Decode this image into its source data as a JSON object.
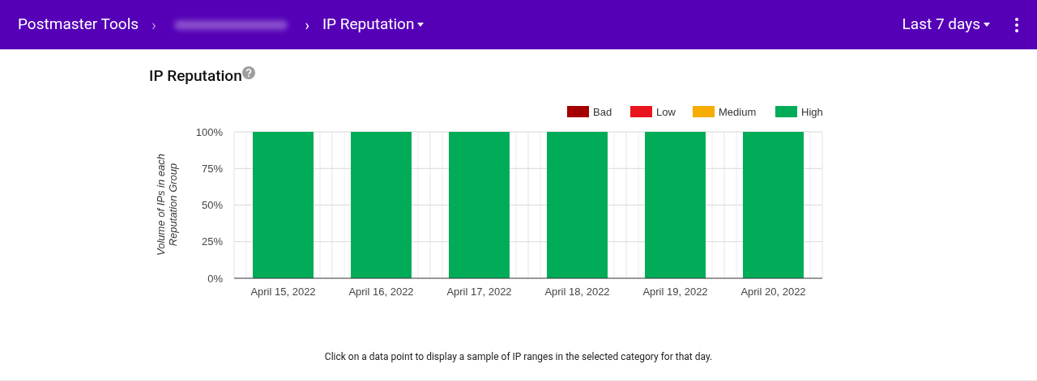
{
  "header": {
    "app_title": "Postmaster Tools",
    "separator": "›",
    "page_menu": "IP Reputation",
    "date_range": "Last 7 days"
  },
  "section": {
    "title": "IP Reputation",
    "chart_data": {
      "type": "bar",
      "stacked": true,
      "grid": true,
      "ylabel": "Volume of IPs in each Reputation Group",
      "categories": [
        "April 15, 2022",
        "April 16, 2022",
        "April 17, 2022",
        "April 18, 2022",
        "April 19, 2022",
        "April 20, 2022"
      ],
      "ylim": [
        0,
        100
      ],
      "yticks": [
        {
          "value": 0,
          "label": "0%"
        },
        {
          "value": 25,
          "label": "25%"
        },
        {
          "value": 50,
          "label": "50%"
        },
        {
          "value": 75,
          "label": "75%"
        },
        {
          "value": 100,
          "label": "100%"
        }
      ],
      "series": [
        {
          "name": "Bad",
          "color": "#a50000",
          "values": [
            0,
            0,
            0,
            0,
            0,
            0
          ]
        },
        {
          "name": "Low",
          "color": "#e8141e",
          "values": [
            0,
            0,
            0,
            0,
            0,
            0
          ]
        },
        {
          "name": "Medium",
          "color": "#f7ac00",
          "values": [
            0,
            0,
            0,
            0,
            0,
            0
          ]
        },
        {
          "name": "High",
          "color": "#00ac58",
          "values": [
            100,
            100,
            100,
            100,
            100,
            100
          ]
        }
      ]
    },
    "hint": "Click on a data point to display a sample of IP ranges in the selected category for that day."
  }
}
